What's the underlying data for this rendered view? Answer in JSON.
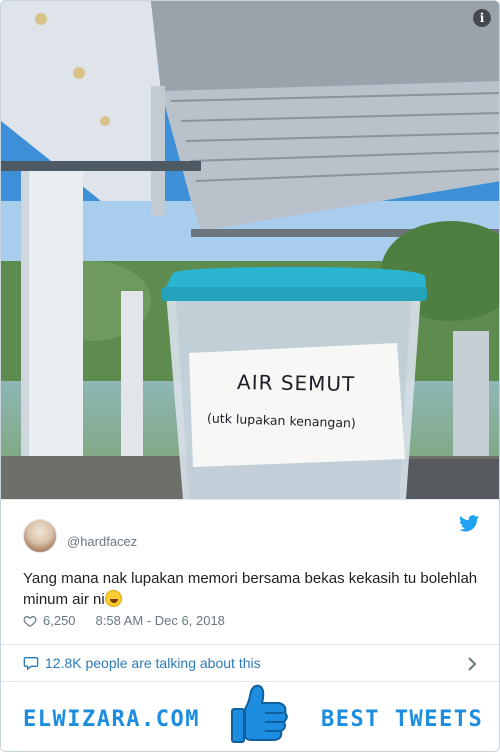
{
  "photo": {
    "alt_subject": "",
    "note_title": "AIR SEMUT",
    "note_subtitle": "(utk lupakan kenangan)",
    "info_icon": "info-icon",
    "info_symbol": "i"
  },
  "tweet": {
    "handle": "@hardfacez",
    "text": "Yang mana nak lupakan memori bersama bekas kekasih tu bolehlah minum air ni",
    "emoji": "rolling-on-floor-laughing-emoji",
    "likes": "6,250",
    "timestamp": "8:58 AM - Dec 6, 2018",
    "talking": "12.8K people are talking about this"
  },
  "banner": {
    "brand": "ELWIZARA.COM",
    "tagline": "BEST TWEETS"
  },
  "colors": {
    "twitter_blue": "#1da1f2",
    "link_blue": "#2b7bb9",
    "brand_blue": "#1d8de0",
    "lid_teal": "#2bb4cf"
  }
}
